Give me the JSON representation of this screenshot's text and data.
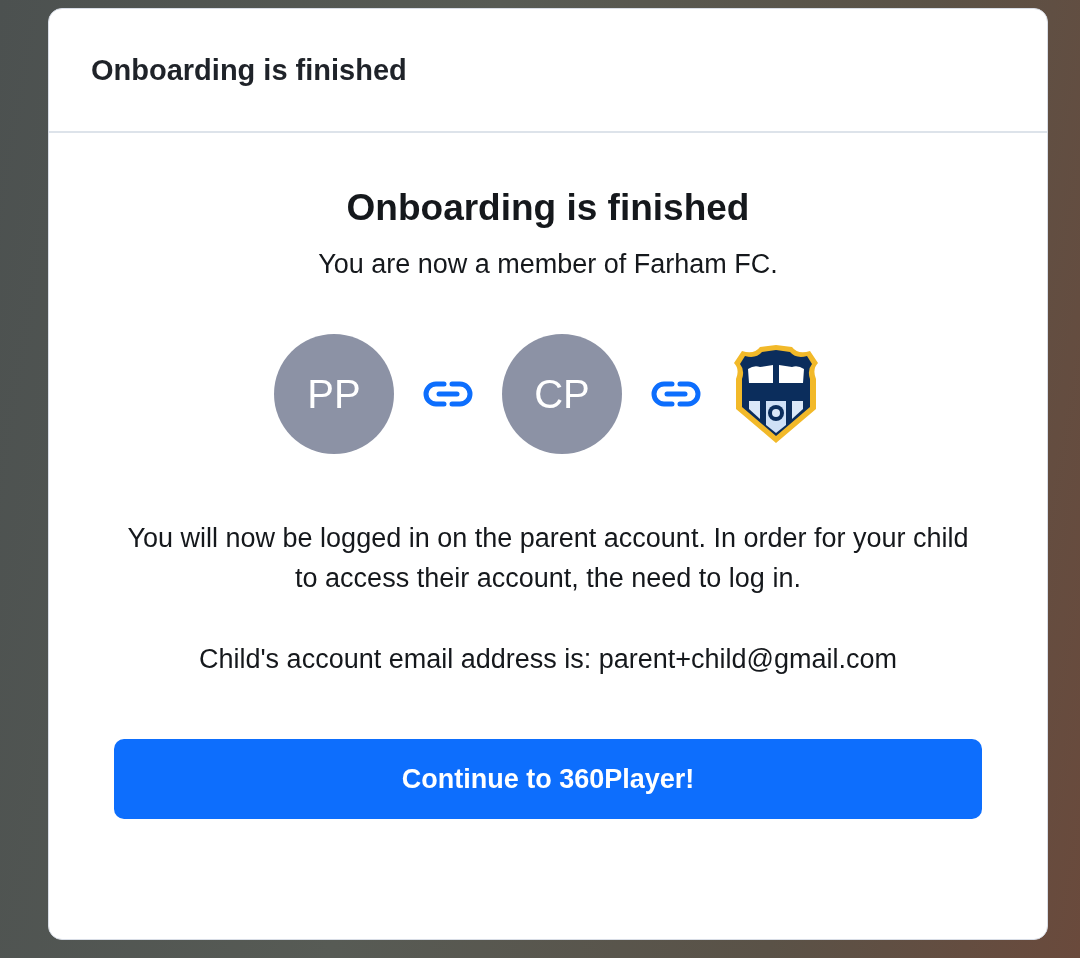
{
  "dialog": {
    "title": "Onboarding is finished"
  },
  "content": {
    "heading": "Onboarding is finished",
    "subtitle": "You are now a member of Farham FC.",
    "chain": [
      {
        "kind": "avatar",
        "initials": "PP"
      },
      {
        "kind": "link"
      },
      {
        "kind": "avatar",
        "initials": "CP"
      },
      {
        "kind": "link"
      },
      {
        "kind": "crest"
      }
    ],
    "message": "You will now be logged in on the parent account. In order for your child to access their account, the need to log in.",
    "email_note": "Child's account email address is: parent+child@gmail.com",
    "button": "Continue to 360Player!"
  }
}
